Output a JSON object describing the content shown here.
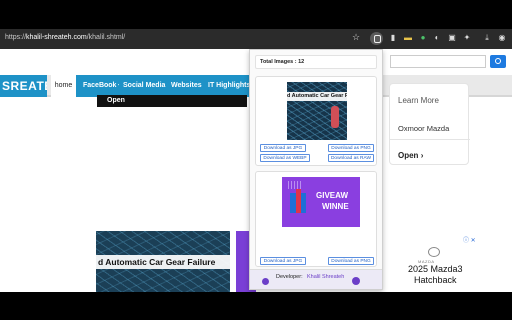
{
  "browser": {
    "url_prefix": "https://",
    "url_domain": "khalil-shreateh.com",
    "url_path": "/khalil.shtml/"
  },
  "page": {
    "logo_text": "SREATEH",
    "nav": {
      "home": "home",
      "items": [
        "FaceBook",
        "Social Media",
        "Websites",
        "IT Highlights"
      ]
    },
    "dropdown_open": "Open",
    "right_card": {
      "line1": "Learn More",
      "line2": "Oxmoor Mazda",
      "open": "Open",
      "chevron": "›"
    },
    "hero_caption": "d Automatic Car Gear Failure",
    "ad": {
      "close": "ⓘ ✕",
      "brand": "MAZDA",
      "line1": "2025 Mazda3",
      "line2": "Hatchback"
    }
  },
  "popup": {
    "total_images": "Total Images : 12",
    "card1": {
      "thumb_caption": "d Automatic Car Gear Failure",
      "buttons": [
        "Download as JPG",
        "Download as PNG",
        "Download as WEBP",
        "Download as RAW"
      ]
    },
    "card2": {
      "thumb_word1": "GIVEAW",
      "thumb_word2": "WINNE",
      "buttons": [
        "Download as JPG",
        "Download as PNG"
      ]
    },
    "developer_label": "Developer:",
    "developer_name": "Khalil Shreateh"
  },
  "colors": {
    "brand_blue": "#1e92c7",
    "popup_accent": "#6b3fc8",
    "download_link": "#1f5fc5"
  }
}
